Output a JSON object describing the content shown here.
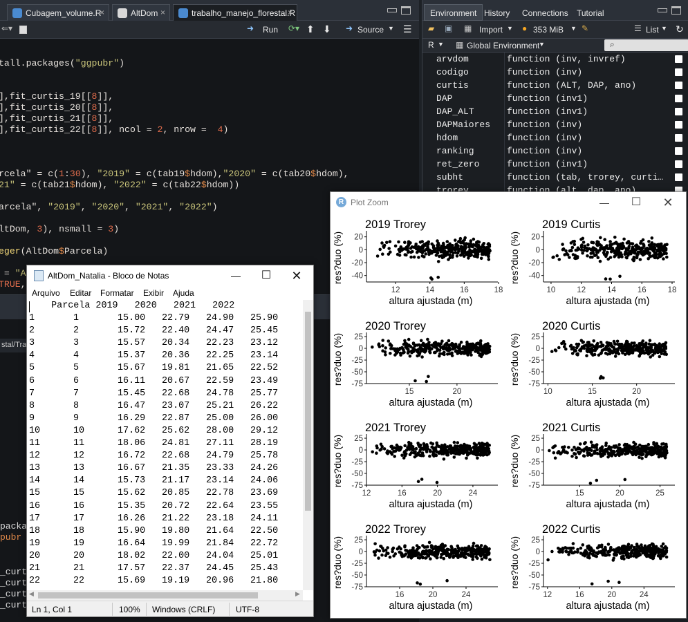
{
  "editor": {
    "tabs": [
      {
        "label": "Cubagem_volume.R",
        "close": "×"
      },
      {
        "label": "AltDom",
        "close": "×"
      },
      {
        "label": "trabalho_manejo_florestal.R",
        "close": "×"
      }
    ],
    "toolbar": {
      "run": "Run",
      "source": "Source"
    },
    "console_path": "stal/Tra"
  },
  "environment": {
    "tabs": [
      "Environment",
      "History",
      "Connections",
      "Tutorial"
    ],
    "toolbar": {
      "import": "Import",
      "memory": "353 MiB",
      "view": "List"
    },
    "lang": "R",
    "scope": "Global Environment",
    "items": [
      {
        "name": "arvdom",
        "value": "function (inv, invref)"
      },
      {
        "name": "codigo",
        "value": "function (inv)"
      },
      {
        "name": "curtis",
        "value": "function (ALT, DAP, ano)"
      },
      {
        "name": "DAP",
        "value": "function (inv1)"
      },
      {
        "name": "DAP_ALT",
        "value": "function (inv1)"
      },
      {
        "name": "DAPMaiores",
        "value": "function (inv)"
      },
      {
        "name": "hdom",
        "value": "function (inv)"
      },
      {
        "name": "ranking",
        "value": "function (inv)"
      },
      {
        "name": "ret_zero",
        "value": "function (inv1)"
      },
      {
        "name": "subht",
        "value": "function (tab, trorey, curti…"
      },
      {
        "name": "trorey",
        "value": "function (alt, dap, ano)"
      }
    ]
  },
  "notepad": {
    "title": "AltDom_Natalia - Bloco de Notas",
    "menu": [
      "Arquivo",
      "Editar",
      "Formatar",
      "Exibir",
      "Ajuda"
    ],
    "header": "    Parcela 2019   2020   2021   2022",
    "rows": [
      [
        "1",
        "1",
        "15.00",
        "22.79",
        "24.90",
        "25.90"
      ],
      [
        "2",
        "2",
        "15.72",
        "22.40",
        "24.47",
        "25.45"
      ],
      [
        "3",
        "3",
        "15.57",
        "20.34",
        "22.23",
        "23.12"
      ],
      [
        "4",
        "4",
        "15.37",
        "20.36",
        "22.25",
        "23.14"
      ],
      [
        "5",
        "5",
        "15.67",
        "19.81",
        "21.65",
        "22.52"
      ],
      [
        "6",
        "6",
        "16.11",
        "20.67",
        "22.59",
        "23.49"
      ],
      [
        "7",
        "7",
        "15.45",
        "22.68",
        "24.78",
        "25.77"
      ],
      [
        "8",
        "8",
        "16.47",
        "23.07",
        "25.21",
        "26.22"
      ],
      [
        "9",
        "9",
        "16.29",
        "22.87",
        "25.00",
        "26.00"
      ],
      [
        "10",
        "10",
        "17.62",
        "25.62",
        "28.00",
        "29.12"
      ],
      [
        "11",
        "11",
        "18.06",
        "24.81",
        "27.11",
        "28.19"
      ],
      [
        "12",
        "12",
        "16.72",
        "22.68",
        "24.79",
        "25.78"
      ],
      [
        "13",
        "13",
        "16.67",
        "21.35",
        "23.33",
        "24.26"
      ],
      [
        "14",
        "14",
        "15.73",
        "21.17",
        "23.14",
        "24.06"
      ],
      [
        "15",
        "15",
        "15.62",
        "20.85",
        "22.78",
        "23.69"
      ],
      [
        "16",
        "16",
        "15.35",
        "20.72",
        "22.64",
        "23.55"
      ],
      [
        "17",
        "17",
        "16.26",
        "21.22",
        "23.18",
        "24.11"
      ],
      [
        "18",
        "18",
        "15.90",
        "19.80",
        "21.64",
        "22.50"
      ],
      [
        "19",
        "19",
        "16.64",
        "19.99",
        "21.84",
        "22.72"
      ],
      [
        "20",
        "20",
        "18.02",
        "22.00",
        "24.04",
        "25.01"
      ],
      [
        "21",
        "21",
        "17.57",
        "22.37",
        "24.45",
        "25.43"
      ],
      [
        "22",
        "22",
        "15.69",
        "19.19",
        "20.96",
        "21.80"
      ]
    ],
    "status": {
      "position": "Ln 1, Col 1",
      "zoom": "100%",
      "eol": "Windows (CRLF)",
      "encoding": "UTF-8"
    }
  },
  "plot_zoom": {
    "title": "Plot Zoom"
  },
  "chart_data": [
    {
      "type": "scatter",
      "title": "2019  Trorey",
      "xlabel": "altura ajustada (m)",
      "ylabel": "res?duo (%)",
      "xlim": [
        10.3,
        17.8
      ],
      "ylim": [
        -50,
        25
      ],
      "xticks": [
        12,
        14,
        16,
        18
      ],
      "yticks": [
        20,
        0,
        -20,
        -40
      ],
      "seed": 1
    },
    {
      "type": "scatter",
      "title": "2019  Curtis",
      "xlabel": "altura ajustada (m)",
      "ylabel": "res?duo (%)",
      "xlim": [
        9.5,
        18
      ],
      "ylim": [
        -50,
        25
      ],
      "xticks": [
        10,
        12,
        14,
        16,
        18
      ],
      "yticks": [
        20,
        0,
        -20,
        -40
      ],
      "seed": 2
    },
    {
      "type": "scatter",
      "title": "2020  Trorey",
      "xlabel": "altura ajustada (m)",
      "ylabel": "res?duo (%)",
      "xlim": [
        10.5,
        24
      ],
      "ylim": [
        -75,
        28
      ],
      "xticks": [
        15,
        20
      ],
      "yticks": [
        25,
        0,
        -25,
        -50,
        -75
      ],
      "seed": 3
    },
    {
      "type": "scatter",
      "title": "2020  Curtis",
      "xlabel": "altura ajustada (m)",
      "ylabel": "res?duo (%)",
      "xlim": [
        9.5,
        24
      ],
      "ylim": [
        -75,
        28
      ],
      "xticks": [
        10,
        15,
        20
      ],
      "yticks": [
        25,
        0,
        -25,
        -50,
        -75
      ],
      "seed": 4
    },
    {
      "type": "scatter",
      "title": "2021  Trorey",
      "xlabel": "altura ajustada (m)",
      "ylabel": "res?duo (%)",
      "xlim": [
        12,
        26.5
      ],
      "ylim": [
        -75,
        28
      ],
      "xticks": [
        12,
        16,
        20,
        24
      ],
      "yticks": [
        25,
        0,
        -25,
        -50,
        -75
      ],
      "seed": 5
    },
    {
      "type": "scatter",
      "title": "2021  Curtis",
      "xlabel": "altura ajustada (m)",
      "ylabel": "res?duo (%)",
      "xlim": [
        10.5,
        26.5
      ],
      "ylim": [
        -75,
        28
      ],
      "xticks": [
        15,
        20,
        25
      ],
      "yticks": [
        25,
        0,
        -25,
        -50,
        -75
      ],
      "seed": 6
    },
    {
      "type": "scatter",
      "title": "2022  Trorey",
      "xlabel": "altura ajustada (m)",
      "ylabel": "res?duo (%)",
      "xlim": [
        12,
        27.5
      ],
      "ylim": [
        -75,
        28
      ],
      "xticks": [
        16,
        20,
        24
      ],
      "yticks": [
        25,
        0,
        -25,
        -50,
        -75
      ],
      "seed": 7
    },
    {
      "type": "scatter",
      "title": "2022  Curtis",
      "xlabel": "altura ajustada (m)",
      "ylabel": "res?duo (%)",
      "xlim": [
        11.5,
        27.5
      ],
      "ylim": [
        -75,
        28
      ],
      "xticks": [
        12,
        16,
        20,
        24
      ],
      "yticks": [
        25,
        0,
        -25,
        -50,
        -75
      ],
      "seed": 8
    }
  ]
}
